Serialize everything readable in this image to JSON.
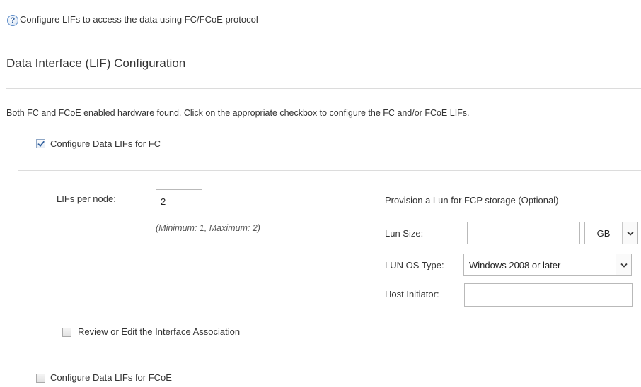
{
  "header": {
    "help_text": "Configure LIFs to access the data using FC/FCoE protocol"
  },
  "section": {
    "title": "Data Interface (LIF) Configuration",
    "info": "Both FC and FCoE enabled hardware found. Click on the appropriate checkbox to configure the FC and/or FCoE LIFs."
  },
  "fc": {
    "checkbox_label": "Configure Data LIFs for FC",
    "checked": true,
    "lifs_per_node_label": "LIFs per node:",
    "lifs_per_node_value": "2",
    "lifs_hint": "(Minimum: 1, Maximum: 2)",
    "review_label": "Review or Edit the Interface Association",
    "review_checked": false
  },
  "lun": {
    "heading": "Provision a Lun for FCP storage (Optional)",
    "size_label": "Lun Size:",
    "size_value": "",
    "size_unit": "GB",
    "os_type_label": "LUN OS Type:",
    "os_type_value": "Windows 2008 or later",
    "host_initiator_label": "Host Initiator:",
    "host_initiator_value": ""
  },
  "fcoe": {
    "checkbox_label": "Configure Data LIFs for FCoE",
    "checked": false
  },
  "colors": {
    "rule": "#dcdcdc",
    "check": "#2f5f9e",
    "help_icon": "#5b8bc8"
  },
  "icons": {
    "help": "question-mark-icon",
    "dropdown": "chevron-down-icon",
    "check": "check-mark-icon"
  }
}
